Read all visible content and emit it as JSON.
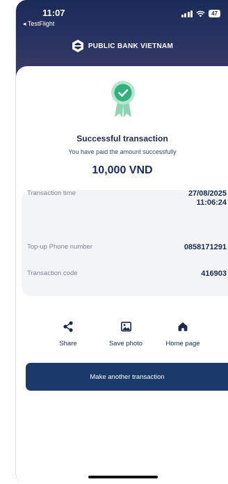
{
  "status_bar": {
    "time": "11:07",
    "back_app": "◂ TestFlight",
    "battery": "47"
  },
  "brand": {
    "name": "PUBLIC BANK VIETNAM",
    "colors": {
      "primary": "#1a2b58",
      "success": "#34b07f",
      "button": "#1b3a6b"
    }
  },
  "result": {
    "title": "Successful transaction",
    "subtitle": "You have paid the amount successfully",
    "amount": "10,000 VND",
    "icon": "success-badge-icon"
  },
  "details": [
    {
      "label": "Transaction time",
      "value_line1": "27/08/2025",
      "value_line2": "11:06:24"
    },
    {
      "label": "Top-up Phone number",
      "value": "0858171291"
    },
    {
      "label": "Transaction code",
      "value": "416903"
    }
  ],
  "actions": [
    {
      "label": "Share",
      "icon": "share-icon"
    },
    {
      "label": "Save photo",
      "icon": "image-icon"
    },
    {
      "label": "Home page",
      "icon": "home-icon"
    }
  ],
  "primary_button": {
    "label": "Make another transaction"
  }
}
